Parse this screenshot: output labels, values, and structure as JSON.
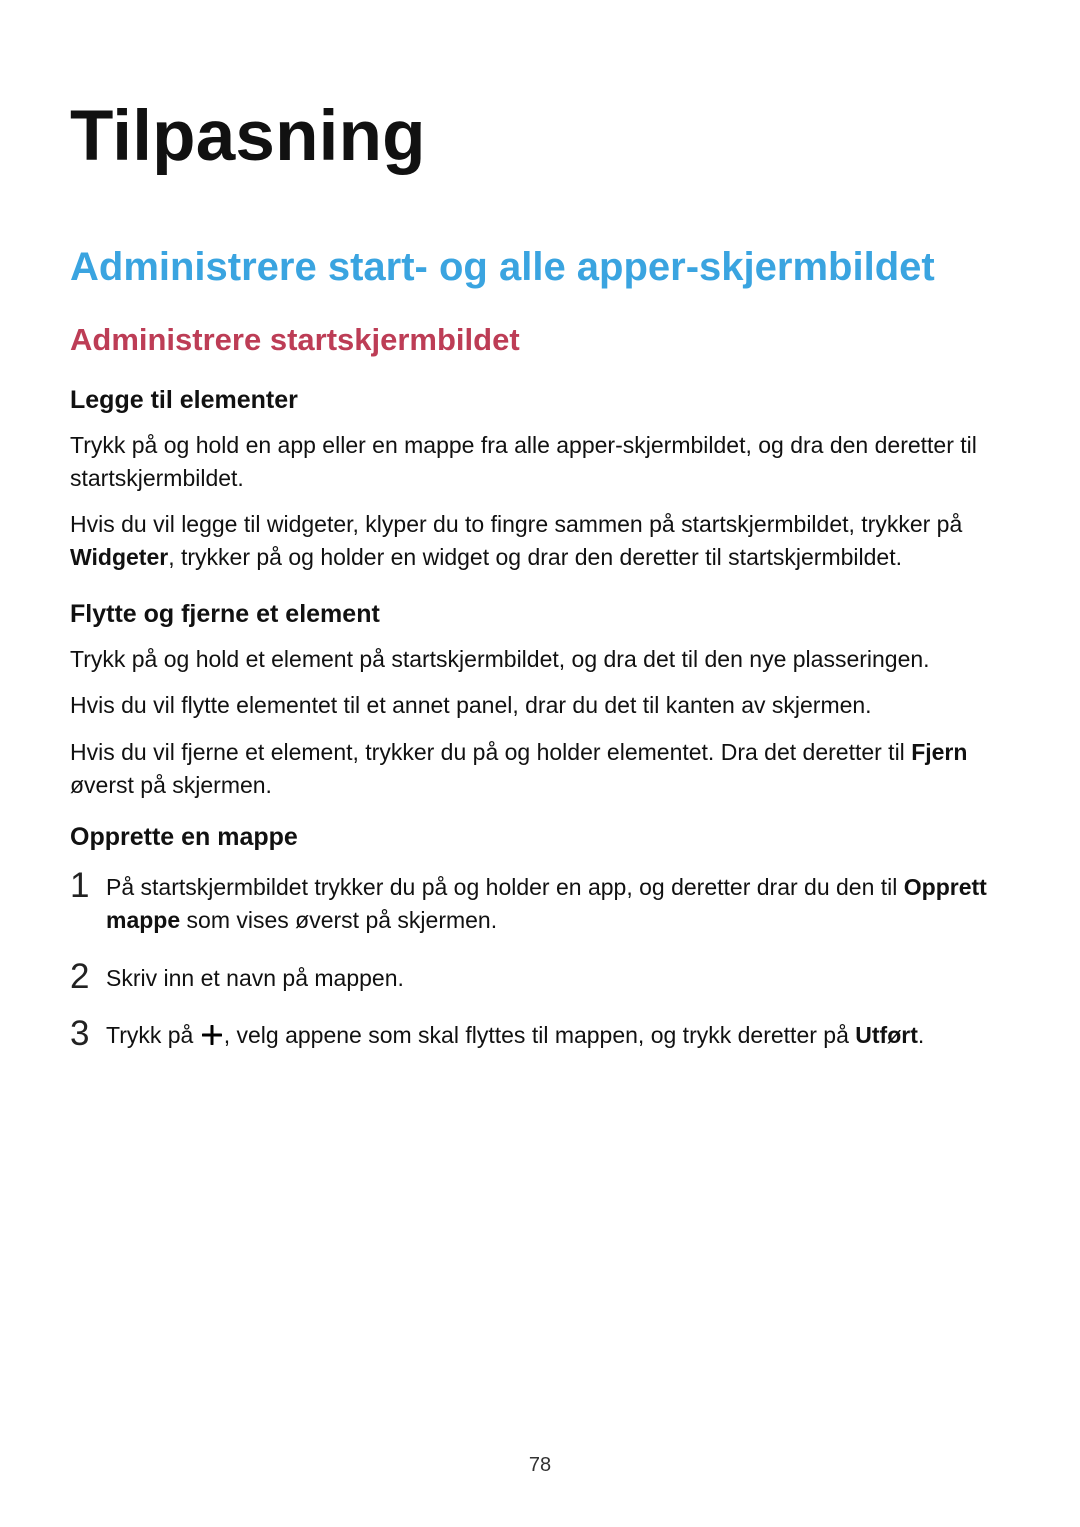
{
  "page": {
    "title": "Tilpasning",
    "section_title": "Administrere start- og alle apper-skjermbildet",
    "subsection_title": "Administrere startskjermbildet",
    "add_items": {
      "heading": "Legge til elementer",
      "p1": "Trykk på og hold en app eller en mappe fra alle apper-skjermbildet, og dra den deretter til startskjermbildet.",
      "p2_pre": "Hvis du vil legge til widgeter, klyper du to fingre sammen på startskjermbildet, trykker på ",
      "p2_bold": "Widgeter",
      "p2_post": ", trykker på og holder en widget og drar den deretter til startskjermbildet."
    },
    "move_items": {
      "heading": "Flytte og fjerne et element",
      "p1": "Trykk på og hold et element på startskjermbildet, og dra det til den nye plasseringen.",
      "p2": "Hvis du vil flytte elementet til et annet panel, drar du det til kanten av skjermen.",
      "p3_pre": "Hvis du vil fjerne et element, trykker du på og holder elementet. Dra det deretter til ",
      "p3_bold": "Fjern",
      "p3_post": " øverst på skjermen."
    },
    "create_folder": {
      "heading": "Opprette en mappe",
      "step1_pre": "På startskjermbildet trykker du på og holder en app, og deretter drar du den til ",
      "step1_bold": "Opprett mappe",
      "step1_post": " som vises øverst på skjermen.",
      "step2": "Skriv inn et navn på mappen.",
      "step3_pre": "Trykk på ",
      "step3_mid": ", velg appene som skal flyttes til mappen, og trykk deretter på ",
      "step3_bold": "Utført",
      "step3_post": "."
    },
    "number": "78"
  }
}
